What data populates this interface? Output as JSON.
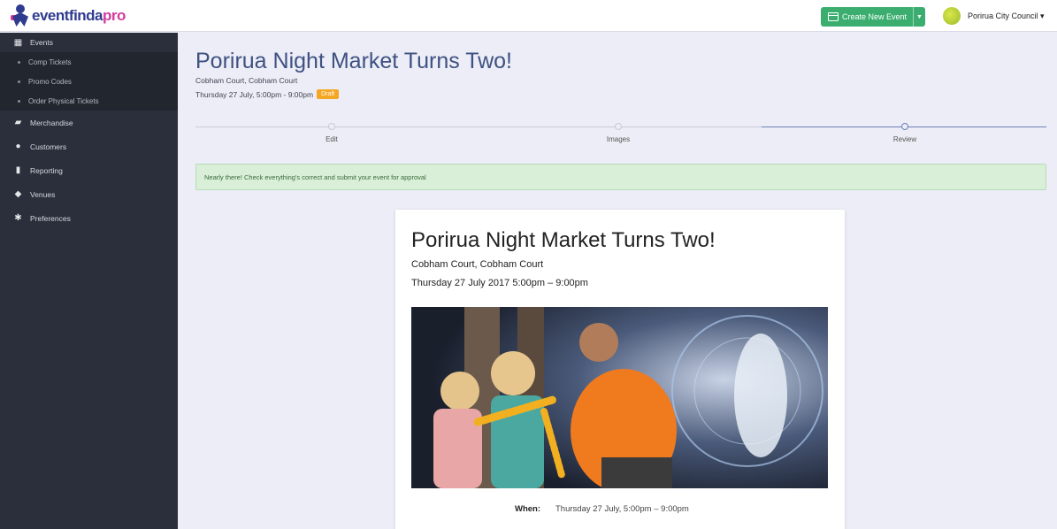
{
  "brand": {
    "part1": "eventfinda",
    "part2": "pro"
  },
  "header": {
    "create_label": "Create New Event",
    "account_label": "Porirua City Council ▾"
  },
  "sidebar": {
    "items": [
      {
        "label": "Events",
        "icon": "calendar-icon",
        "sub": false
      },
      {
        "label": "Comp Tickets",
        "sub": true
      },
      {
        "label": "Promo Codes",
        "sub": true
      },
      {
        "label": "Order Physical Tickets",
        "sub": true
      },
      {
        "label": "Merchandise",
        "icon": "bag-icon",
        "sub": false
      },
      {
        "label": "Customers",
        "icon": "users-icon",
        "sub": false
      },
      {
        "label": "Reporting",
        "icon": "bar-chart-icon",
        "sub": false
      },
      {
        "label": "Venues",
        "icon": "map-marker-icon",
        "sub": false
      },
      {
        "label": "Preferences",
        "icon": "gear-icon",
        "sub": false
      }
    ]
  },
  "event": {
    "title": "Porirua Night Market Turns Two!",
    "location": "Cobham Court, Cobham Court",
    "datetime": "Thursday 27 July, 5:00pm - 9:00pm",
    "status": "Draft"
  },
  "steps": [
    {
      "label": "Edit"
    },
    {
      "label": "Images"
    },
    {
      "label": "Review"
    }
  ],
  "notice": "Nearly there! Check everything's correct and submit your event for approval",
  "preview": {
    "title": "Porirua Night Market Turns Two!",
    "location": "Cobham Court, Cobham Court",
    "datetime": "Thursday 27 July 2017 5:00pm – 9:00pm",
    "when_label": "When:",
    "when_value": "Thursday 27 July, 5:00pm – 9:00pm"
  },
  "colors": {
    "accent_green": "#3bae6f",
    "sidebar": "#2a2f3b",
    "title_blue": "#3e5182",
    "draft": "#f5a623"
  }
}
